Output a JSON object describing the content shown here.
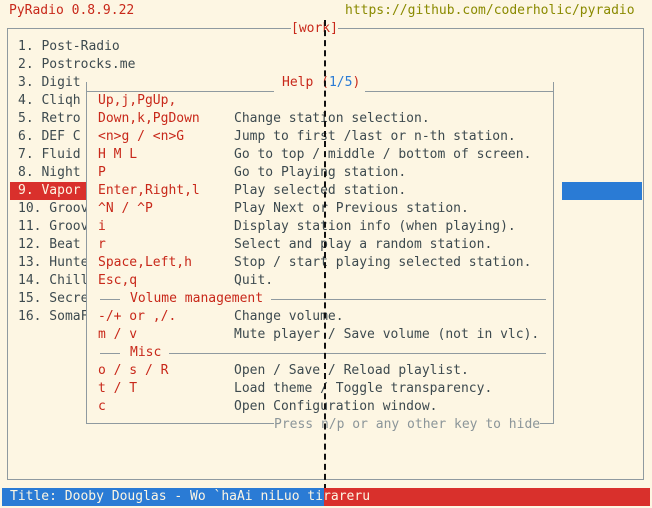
{
  "app": {
    "title": "PyRadio 0.8.9.22",
    "url": "https://github.com/coderholic/pyradio"
  },
  "playlist": {
    "name": "[work]",
    "stations": [
      "1. Post-Radio",
      "2. Postrocks.me",
      "3. Digit",
      "4. Cliqh",
      "5. Retro",
      "6. DEF C",
      "7. Fluid",
      "8. Night",
      "9. Vapor",
      "10. Groov",
      "11. Groov",
      "12. Beat",
      "13. Hunte",
      "14. Chill",
      "15. Secre",
      "16. SomaF"
    ],
    "selected_index": 8
  },
  "help": {
    "title": "Help (1/5)",
    "rows": [
      {
        "keys": "Up,j,PgUp,",
        "desc": ""
      },
      {
        "keys": "Down,k,PgDown",
        "desc": "Change station selection."
      },
      {
        "keys": "<n>g / <n>G",
        "desc": "Jump to first /last or n-th station."
      },
      {
        "keys": "H M L",
        "desc": "Go to top / middle / bottom of screen."
      },
      {
        "keys": "P",
        "desc": "Go to Playing station."
      },
      {
        "keys": "Enter,Right,l",
        "desc": "Play selected station."
      },
      {
        "keys": "^N / ^P",
        "desc": "Play Next or Previous station."
      },
      {
        "keys": "i",
        "desc": "Display station info (when playing)."
      },
      {
        "keys": "r",
        "desc": "Select and play a random station."
      },
      {
        "keys": "Space,Left,h",
        "desc": "Stop / start playing selected station."
      },
      {
        "keys": "Esc,q",
        "desc": "Quit."
      },
      {
        "section": "Volume management"
      },
      {
        "keys": "-/+ or ,/.",
        "desc": "Change volume."
      },
      {
        "keys": "m / v",
        "desc": "Mute player / Save volume (not in vlc)."
      },
      {
        "section": "Misc"
      },
      {
        "keys": "o / s / R",
        "desc": "Open / Save / Reload playlist."
      },
      {
        "keys": "t / T",
        "desc": "Load theme / Toggle transparency."
      },
      {
        "keys": "c",
        "desc": "Open Configuration window."
      }
    ],
    "footer": "Press n/p or any other key to hide"
  },
  "status": {
    "title_text": "Title: Dooby Douglas - Wo `haAi niLuo tirareru"
  },
  "colors": {
    "background": "#fdf6e3",
    "accent": "#c8281a",
    "selection": "#d9302c",
    "status_left": "#2a7bd5",
    "highlight_blue": "#2a7bd5",
    "selected_bar_right": "#2a7bd5"
  }
}
